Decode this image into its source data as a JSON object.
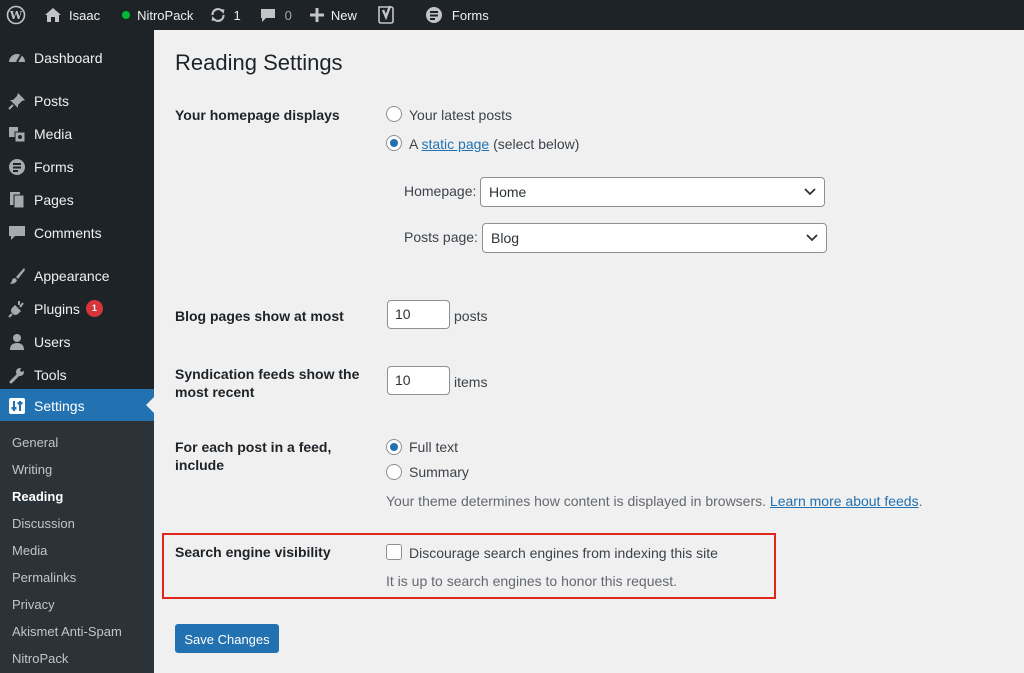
{
  "adminbar": {
    "site_name": "Isaac",
    "nitropack": "NitroPack",
    "updates_count": "1",
    "comments_count": "0",
    "new_label": "New",
    "forms_label": "Forms",
    "nitropack_status_color": "#00ba37"
  },
  "sidebar": {
    "items": [
      {
        "label": "Dashboard"
      },
      {
        "label": "Posts"
      },
      {
        "label": "Media"
      },
      {
        "label": "Forms"
      },
      {
        "label": "Pages"
      },
      {
        "label": "Comments"
      },
      {
        "label": "Appearance"
      },
      {
        "label": "Plugins",
        "badge": "1"
      },
      {
        "label": "Users"
      },
      {
        "label": "Tools"
      },
      {
        "label": "Settings"
      }
    ],
    "submenu": [
      "General",
      "Writing",
      "Reading",
      "Discussion",
      "Media",
      "Permalinks",
      "Privacy",
      "Akismet Anti-Spam",
      "NitroPack"
    ]
  },
  "page": {
    "title": "Reading Settings",
    "homepage_displays": {
      "label": "Your homepage displays",
      "option_latest": "Your latest posts",
      "option_static_prefix": "A",
      "option_static_link": "static page",
      "option_static_suffix": "(select below)",
      "homepage_label": "Homepage:",
      "homepage_value": "Home",
      "posts_page_label": "Posts page:",
      "posts_page_value": "Blog"
    },
    "blog_pages": {
      "label": "Blog pages show at most",
      "value": "10",
      "unit": "posts"
    },
    "syndication": {
      "label_line1": "Syndication feeds show the",
      "label_line2": "most recent",
      "value": "10",
      "unit": "items"
    },
    "feed_content": {
      "label_line1": "For each post in a feed,",
      "label_line2": "include",
      "option_full": "Full text",
      "option_summary": "Summary",
      "description": "Your theme determines how content is displayed in browsers.",
      "learn_more": "Learn more about feeds",
      "learn_more_suffix": "."
    },
    "search_visibility": {
      "label": "Search engine visibility",
      "checkbox_label": "Discourage search engines from indexing this site",
      "description": "It is up to search engines to honor this request."
    },
    "save_button": "Save Changes"
  },
  "colors": {
    "accent": "#2271b1",
    "highlight_border": "#e0261b",
    "adminbar_bg": "#1d2327",
    "badge": "#d63638"
  }
}
